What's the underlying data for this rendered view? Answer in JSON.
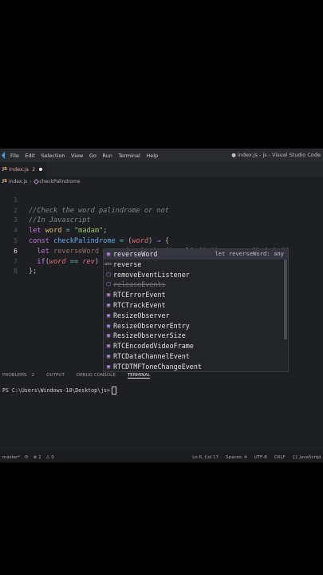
{
  "menubar": {
    "items": [
      "File",
      "Edit",
      "Selection",
      "View",
      "Go",
      "Run",
      "Terminal",
      "Help"
    ],
    "title": "● index.js - js - Visual Studio Code"
  },
  "tab": {
    "badge": "JS",
    "name": "index.js",
    "problems": "2"
  },
  "breadcrumb": {
    "file": "index.js",
    "symbol": "checkPalindrome"
  },
  "gutter": [
    "1",
    "2",
    "3",
    "4",
    "5",
    "6",
    "7",
    "8"
  ],
  "suggest": {
    "items": [
      {
        "icon": "variable-icon",
        "label": "reverseWord",
        "detail": "let reverseWord: any"
      },
      {
        "icon": "abc-icon",
        "label": "reverse",
        "detail": ""
      },
      {
        "icon": "method-icon",
        "label": "removeEventListener",
        "detail": ""
      },
      {
        "icon": "method-icon",
        "label": "releaseEvents",
        "detail": ""
      },
      {
        "icon": "variable-icon",
        "label": "RTCErrorEvent",
        "detail": ""
      },
      {
        "icon": "variable-icon",
        "label": "RTCTrackEvent",
        "detail": ""
      },
      {
        "icon": "variable-icon",
        "label": "ResizeObserver",
        "detail": ""
      },
      {
        "icon": "variable-icon",
        "label": "ResizeObserverEntry",
        "detail": ""
      },
      {
        "icon": "variable-icon",
        "label": "ResizeObserverSize",
        "detail": ""
      },
      {
        "icon": "variable-icon",
        "label": "RTCEncodedVideoFrame",
        "detail": ""
      },
      {
        "icon": "variable-icon",
        "label": "RTCDataChannelEvent",
        "detail": ""
      },
      {
        "icon": "variable-icon",
        "label": "RTCDTMFToneChangeEvent",
        "detail": ""
      }
    ]
  },
  "panel": {
    "tabs": [
      "PROBLEMS",
      "OUTPUT",
      "DEBUG CONSOLE",
      "TERMINAL"
    ],
    "problems_count": "2",
    "active_tab": "TERMINAL",
    "prompt": "PS C:\\Users\\Windows-10\\Desktop\\js>"
  },
  "statusbar": {
    "branch": "master*",
    "sync": "⟳",
    "errors": "⊗ 2",
    "warnings": "⚠ 0",
    "position": "Ln 6, Col 17",
    "spaces": "Spaces: 4",
    "encoding": "UTF-8",
    "eol": "CRLF",
    "language": "{} JavaScript"
  },
  "colors": {
    "background": "#1e1f22",
    "keyword": "#c678dd",
    "string": "#98c379",
    "function": "#61afef"
  }
}
